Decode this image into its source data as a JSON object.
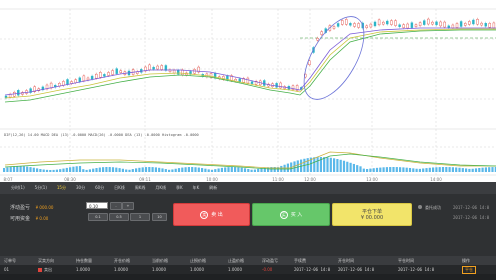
{
  "chart": {
    "indicator_line": "DIF(12,26) 14.00 MACD  DEA (13) -0.0000   MACD(26) -0.0000  DEA (13) -0.0000  Histogram -0.0000",
    "x_labels": [
      "8:07",
      "08:30",
      "09:11",
      "10:00",
      "11:00",
      "12:00",
      "13:00",
      "14:00"
    ]
  },
  "tabs": [
    "分时(1)",
    "5分(1)",
    "15分",
    "30分",
    "60分",
    "日K线",
    "周K线",
    "月K线",
    "季K",
    "年K",
    "刷新"
  ],
  "active_tab": 2,
  "account": {
    "float_profit_label": "浮动盈亏",
    "float_profit_value": "¥ 000.00",
    "available_label": "可用资金",
    "available_value": "¥ 0.00"
  },
  "order": {
    "qty_value": "0.10",
    "qty_buttons_row1": [
      "0.1",
      "0.5",
      "1"
    ],
    "qty_buttons_row2": [
      "1",
      "5",
      "10"
    ],
    "sell_label": "卖 出",
    "buy_label": "买 入",
    "close_label_1": "平仓下单",
    "close_label_2": "¥ 00.000"
  },
  "side_info": {
    "label": "委托成功",
    "line1": "2017-12-06 14:0",
    "line2": "2017-12-06 14:0"
  },
  "table": {
    "headers": [
      "订单号",
      "买卖方向",
      "持仓数量",
      "开仓价格",
      "当前价格",
      "止损价格",
      "止盈价格",
      "浮动盈亏",
      "手续费",
      "开仓时间",
      "平仓时间",
      "操作"
    ],
    "row": [
      "01",
      "卖出",
      "1.0000",
      "1.0000",
      "1.0000",
      "1.0000",
      "1.0000",
      "-0.00",
      "2017-12-06 14:0",
      "2017-12-06 14:0",
      "2017-12-06 14:0",
      "平仓"
    ]
  },
  "colors": {
    "up": "#e0443c",
    "down": "#2ab3c6",
    "sell": "#f15b5b",
    "buy": "#66c76a",
    "close": "#f2e46a"
  }
}
